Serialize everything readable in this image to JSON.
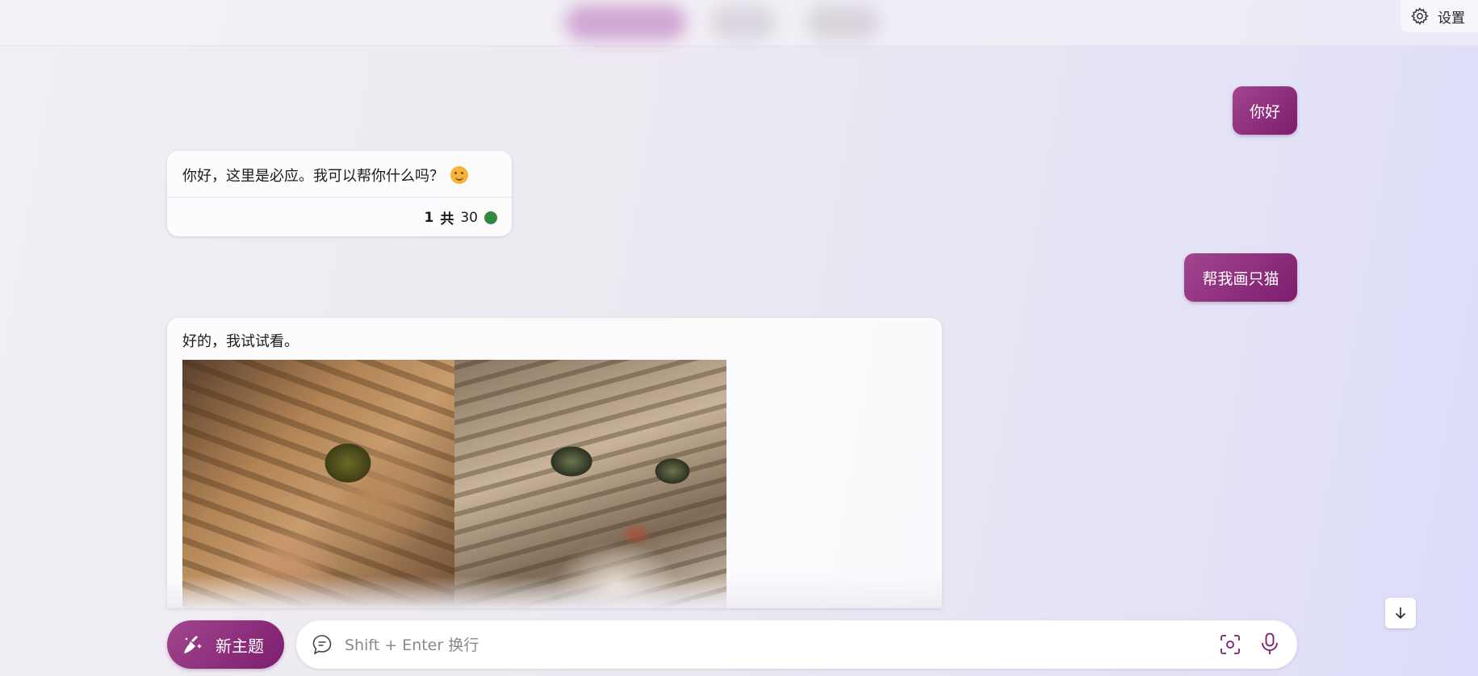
{
  "header": {
    "settings_label": "设置"
  },
  "conversation": {
    "user_messages": [
      "你好",
      "帮我画只猫"
    ],
    "bot_messages": [
      {
        "text": "你好，这里是必应。我可以帮你什么吗？",
        "counter_current": "1",
        "counter_sep": "共",
        "counter_total": "30"
      },
      {
        "text": "好的，我试试看。"
      }
    ]
  },
  "composer": {
    "new_topic_label": "新主题",
    "placeholder": "Shift + Enter 换行"
  },
  "colors": {
    "accent": "#8a2a7c",
    "status_dot": "#2f8a3f"
  },
  "icons": [
    "gear-icon",
    "broom-icon",
    "chat-bubble-icon",
    "camera-scan-icon",
    "microphone-icon",
    "arrow-down-icon",
    "smile-emoji-icon"
  ]
}
